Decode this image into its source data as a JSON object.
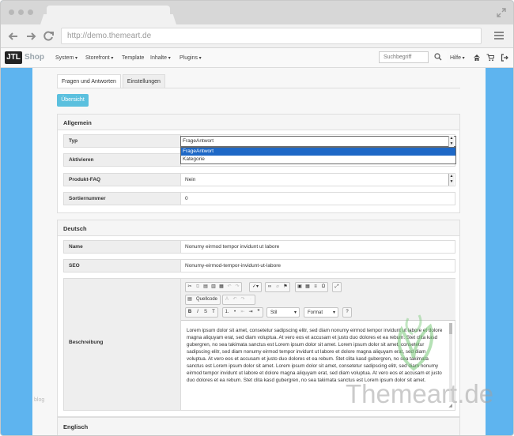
{
  "browser": {
    "url": "http://demo.themeart.de"
  },
  "appnav": {
    "logo": "JTL",
    "logo_suffix": "Shop",
    "menu": [
      "System",
      "Storefront",
      "Template",
      "Inhalte",
      "Plugins"
    ],
    "search_placeholder": "Suchbegriff",
    "help": "Hilfe"
  },
  "tabs": {
    "faq": "Fragen und Antworten",
    "settings": "Einstellungen"
  },
  "overview_button": "Übersicht",
  "general": {
    "heading": "Allgemein",
    "type_label": "Typ",
    "type_value": "FrageAntwort",
    "type_options": [
      "FrageAntwort",
      "Kategorie"
    ],
    "activate_label": "Aktivieren",
    "productfaq_label": "Produkt-FAQ",
    "productfaq_value": "Nein",
    "sort_label": "Sortiernummer",
    "sort_value": "0"
  },
  "german": {
    "heading": "Deutsch",
    "name_label": "Name",
    "name_value": "Nonumy eirmod tempor invidunt ut labore",
    "seo_label": "SEO",
    "seo_value": "Nonumy-eirmod-tempor-invidunt-ut-labore",
    "desc_label": "Beschreibung",
    "editor": {
      "source_label": "Quellcode",
      "style_label": "Stil",
      "format_label": "Format",
      "body": "Lorem ipsum dolor sit amet, consetetur sadipscing elitr, sed diam nonumy eirmod tempor invidunt ut labore et dolore magna aliquyam erat, sed diam voluptua. At vero eos et accusam et justo duo dolores et ea rebum. Stet clita kasd gubergren, no sea takimata sanctus est Lorem ipsum dolor sit amet. Lorem ipsum dolor sit amet, consetetur sadipscing elitr, sed diam nonumy eirmod tempor invidunt ut labore et dolore magna aliquyam erat, sed diam voluptua. At vero eos et accusam et justo duo dolores et ea rebum. Stet clita kasd gubergren, no sea takimata sanctus est Lorem ipsum dolor sit amet. Lorem ipsum dolor sit amet, consetetur sadipscing elitr, sed diam nonumy eirmod tempor invidunt ut labore et dolore magna aliquyam erat, sed diam voluptua. At vero eos et accusam et justo duo dolores et ea rebum. Stet clita kasd gubergren, no sea takimata sanctus est Lorem ipsum dolor sit amet."
    }
  },
  "english": {
    "heading": "Englisch"
  },
  "watermark": "Themeart.de",
  "side_text": "blog",
  "colors": {
    "primary_button": "#5bc0de",
    "selected_option": "#1e68c6",
    "frame_blue": "#5eb4ef"
  }
}
